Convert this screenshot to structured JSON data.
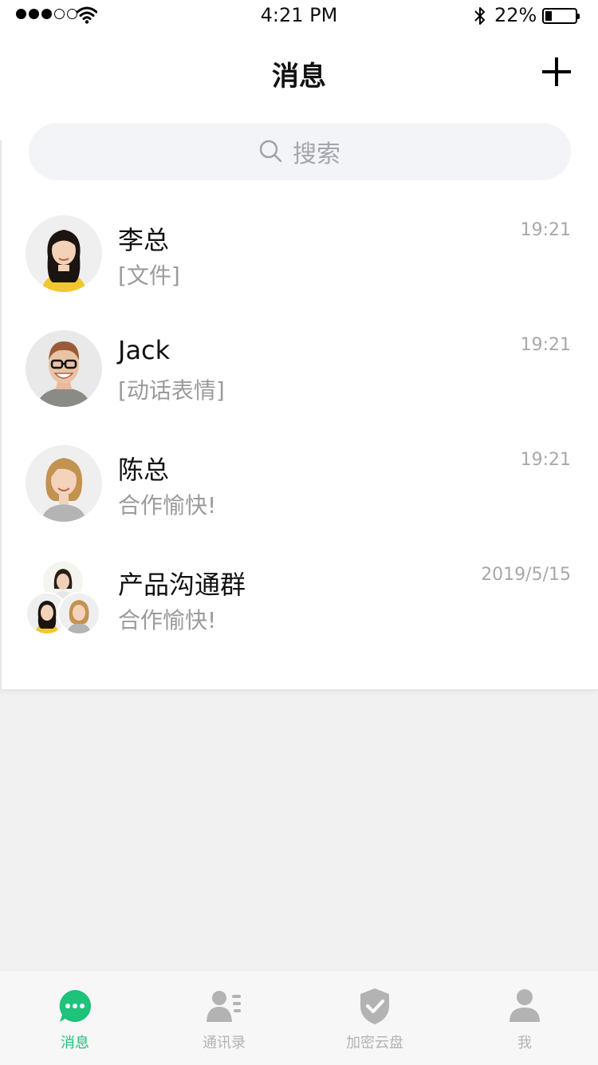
{
  "status_bar": {
    "time": "4:21 PM",
    "battery": "22%"
  },
  "header": {
    "title": "消息"
  },
  "search": {
    "placeholder": "搜索"
  },
  "conversations": [
    {
      "name": "李总",
      "preview": "[文件]",
      "time": "19:21"
    },
    {
      "name": "Jack",
      "preview": "[动话表情]",
      "time": "19:21"
    },
    {
      "name": "陈总",
      "preview": "合作愉快!",
      "time": "19:21"
    },
    {
      "name": "产品沟通群",
      "preview": "合作愉快!",
      "time": "2019/5/15"
    }
  ],
  "tabs": [
    {
      "label": "消息",
      "icon": "chat-bubble-icon",
      "active": true
    },
    {
      "label": "通讯录",
      "icon": "contacts-icon",
      "active": false
    },
    {
      "label": "加密云盘",
      "icon": "shield-check-icon",
      "active": false
    },
    {
      "label": "我",
      "icon": "person-icon",
      "active": false
    }
  ],
  "colors": {
    "accent": "#1ec27b",
    "inactive": "#b3b3b3"
  }
}
